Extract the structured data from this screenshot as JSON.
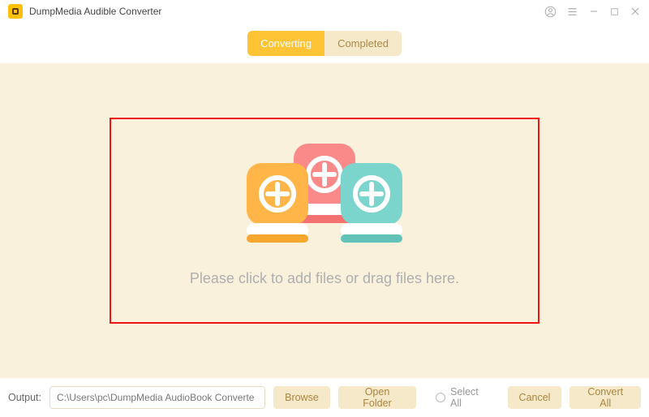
{
  "app": {
    "title": "DumpMedia Audible Converter"
  },
  "tabs": {
    "converting": "Converting",
    "completed": "Completed"
  },
  "dropzone": {
    "hint": "Please click to add files or drag files here."
  },
  "footer": {
    "output_label": "Output:",
    "output_path": "C:\\Users\\pc\\DumpMedia AudioBook Converte",
    "browse": "Browse",
    "open_folder": "Open Folder",
    "select_all": "Select All",
    "cancel": "Cancel",
    "convert_all": "Convert All"
  },
  "colors": {
    "accent": "#ffc436",
    "panel": "#faf1dd",
    "highlight_border": "#f01515"
  }
}
